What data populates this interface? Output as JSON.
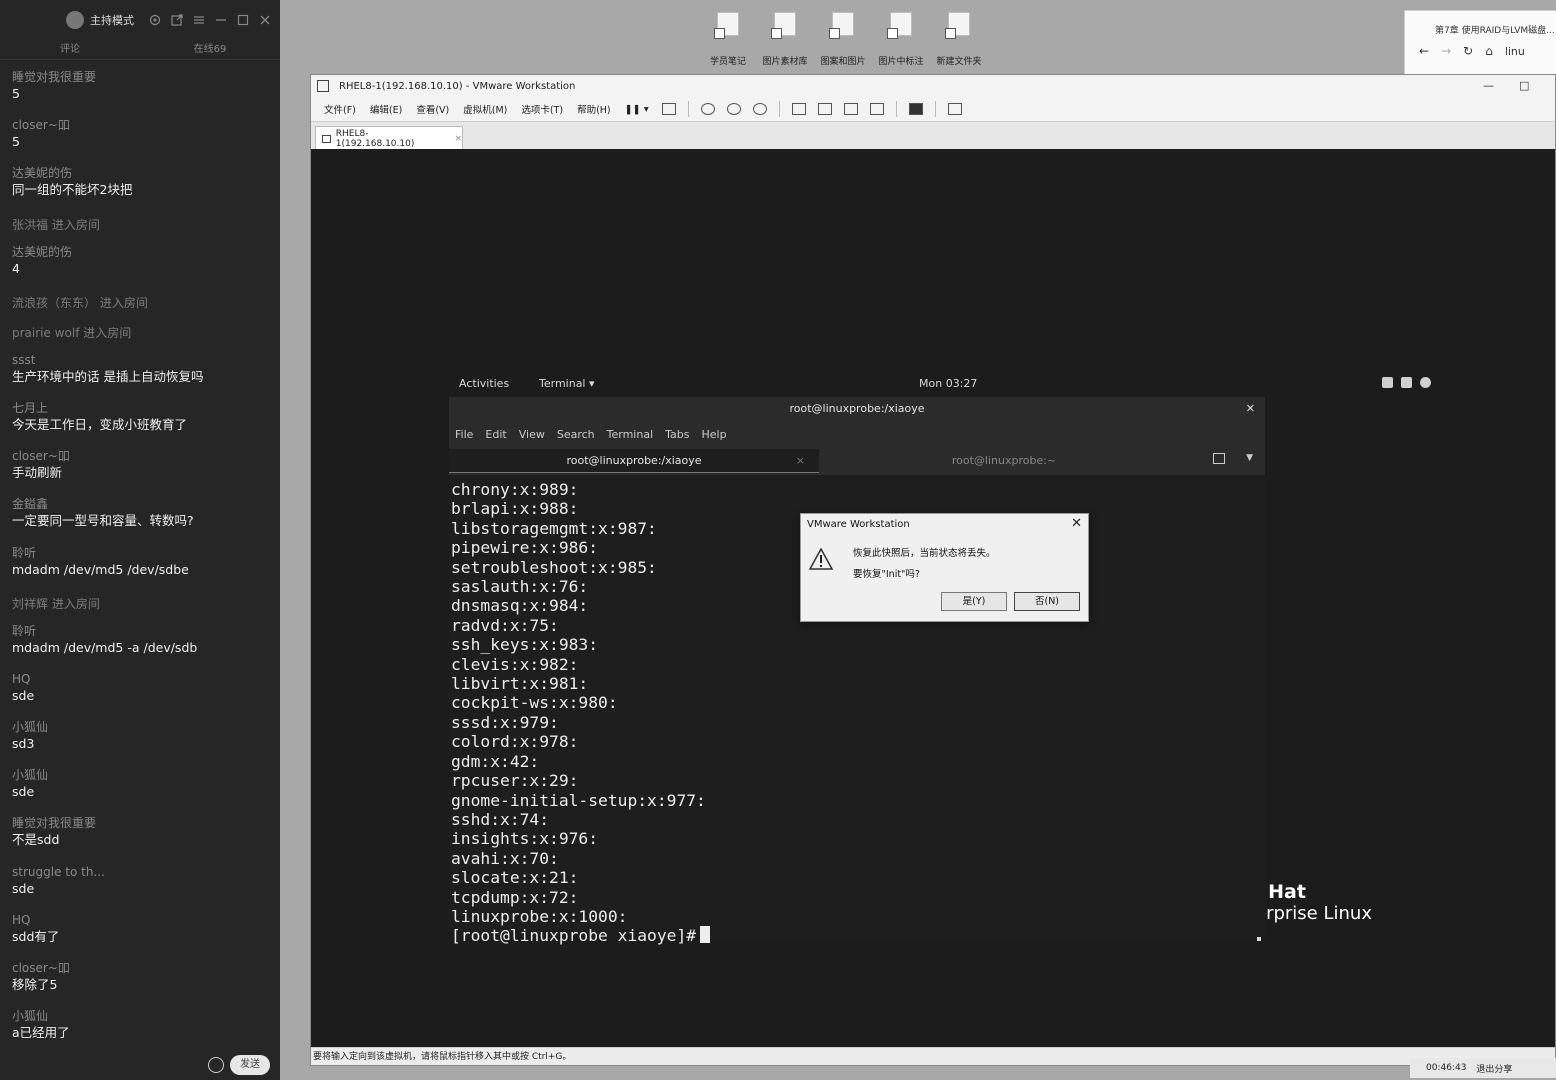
{
  "chat": {
    "mode_label": "主持模式",
    "tabs": [
      "评论",
      "在线69"
    ],
    "messages": [
      {
        "user": "睡觉对我很重要",
        "text": "5"
      },
      {
        "user": "closer~吅",
        "text": "5"
      },
      {
        "user": "达美妮的伤",
        "text": "同一组的不能坏2块把"
      },
      {
        "user": "张洪福 进入房间",
        "text": "",
        "join": true
      },
      {
        "user": "达美妮的伤",
        "text": "4"
      },
      {
        "user": "流浪孩（东东） 进入房间",
        "text": "",
        "join": true
      },
      {
        "user": "prairie wolf 进入房间",
        "text": "",
        "join": true
      },
      {
        "user": "ssst",
        "text": "生产环境中的话 是插上自动恢复吗"
      },
      {
        "user": "七月上",
        "text": "今天是工作日，变成小班教育了"
      },
      {
        "user": "closer~吅",
        "text": "手动刷新"
      },
      {
        "user": "金鎰鑫",
        "text": "一定要同一型号和容量、转数吗?"
      },
      {
        "user": "聆听",
        "text": "mdadm /dev/md5 /dev/sdbe"
      },
      {
        "user": "刘祥辉 进入房间",
        "text": "",
        "join": true
      },
      {
        "user": "聆听",
        "text": "mdadm /dev/md5 -a /dev/sdb"
      },
      {
        "user": "HQ",
        "text": "sde"
      },
      {
        "user": "小狐仙",
        "text": "sd3"
      },
      {
        "user": "小狐仙",
        "text": "sde"
      },
      {
        "user": "睡觉对我很重要",
        "text": "不是sdd"
      },
      {
        "user": "struggle to th...",
        "text": "sde"
      },
      {
        "user": "HQ",
        "text": "sdd有了"
      },
      {
        "user": "closer~吅",
        "text": "移除了5"
      },
      {
        "user": "小狐仙",
        "text": "a已经用了"
      }
    ],
    "send_label": "发送"
  },
  "desktop": {
    "icons": [
      "学员笔记",
      "图片素材库",
      "图案和图片",
      "图片中标注",
      "新建文件夹"
    ]
  },
  "browser": {
    "tab_title": "第7章 使用RAID与LVM磁盘...",
    "address": "linu"
  },
  "vmware": {
    "title": "RHEL8-1(192.168.10.10) - VMware Workstation",
    "menu": [
      "文件(F)",
      "编辑(E)",
      "查看(V)",
      "虚拟机(M)",
      "选项卡(T)",
      "帮助(H)"
    ],
    "tab": "RHEL8-1(192.168.10.10)",
    "status": "要将输入定向到该虚拟机，请将鼠标指针移入其中或按 Ctrl+G。"
  },
  "gnome": {
    "activities": "Activities",
    "app": "Terminal ▾",
    "clock": "Mon 03:27",
    "logo_line1": "l Hat",
    "logo_line2": "erprise Linux"
  },
  "terminal": {
    "title": "root@linuxprobe:/xiaoye",
    "menu": [
      "File",
      "Edit",
      "View",
      "Search",
      "Terminal",
      "Tabs",
      "Help"
    ],
    "tab1": "root@linuxprobe:/xiaoye",
    "tab2": "root@linuxprobe:~",
    "lines": [
      "chrony:x:989:",
      "brlapi:x:988:",
      "libstoragemgmt:x:987:",
      "pipewire:x:986:",
      "setroubleshoot:x:985:",
      "saslauth:x:76:",
      "dnsmasq:x:984:",
      "radvd:x:75:",
      "ssh_keys:x:983:",
      "clevis:x:982:",
      "libvirt:x:981:",
      "cockpit-ws:x:980:",
      "sssd:x:979:",
      "colord:x:978:",
      "gdm:x:42:",
      "rpcuser:x:29:",
      "gnome-initial-setup:x:977:",
      "sshd:x:74:",
      "insights:x:976:",
      "avahi:x:70:",
      "slocate:x:21:",
      "tcpdump:x:72:",
      "linuxprobe:x:1000:"
    ],
    "prompt": "[root@linuxprobe xiaoye]#"
  },
  "dialog": {
    "title": "VMware Workstation",
    "line1": "恢复此快照后，当前状态将丢失。",
    "line2": "要恢复\"Init\"吗?",
    "yes": "是(Y)",
    "no": "否(N)"
  },
  "tray": {
    "time": "00:46:43",
    "exit_share": "退出分享"
  }
}
